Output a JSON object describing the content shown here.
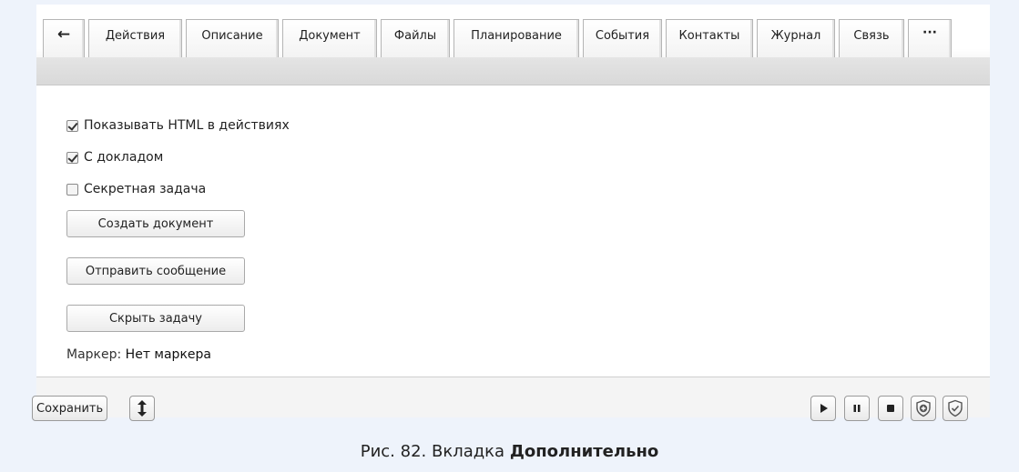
{
  "tabs": [
    {
      "label": "←",
      "icon": "arrow-left-icon"
    },
    {
      "label": "Действия"
    },
    {
      "label": "Описание"
    },
    {
      "label": "Документ"
    },
    {
      "label": "Файлы"
    },
    {
      "label": "Планирование"
    },
    {
      "label": "События"
    },
    {
      "label": "Контакты"
    },
    {
      "label": "Журнал"
    },
    {
      "label": "Связь"
    },
    {
      "label": "···",
      "icon": "more-icon"
    }
  ],
  "options": {
    "show_html": {
      "label": "Показывать HTML в действиях",
      "checked": true
    },
    "with_report": {
      "label": "С докладом",
      "checked": true
    },
    "secret_task": {
      "label": "Секретная задача",
      "checked": false
    }
  },
  "buttons": {
    "create_document": "Создать документ",
    "send_message": "Отправить сообщение",
    "hide_task": "Скрыть задачу"
  },
  "marker": {
    "label": "Маркер:",
    "value": "Нет маркера"
  },
  "footer": {
    "save": "Сохранить",
    "controls": [
      "resize-icon",
      "play-icon",
      "pause-icon",
      "stop-icon",
      "shield-plus-icon",
      "shield-check-icon"
    ]
  },
  "caption": {
    "prefix": "Рис. 82. Вкладка",
    "bold": "Дополнительно"
  }
}
